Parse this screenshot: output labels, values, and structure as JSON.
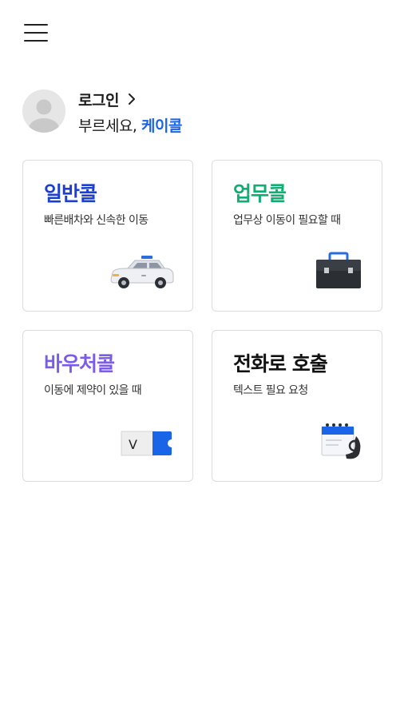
{
  "header": {
    "menu_icon": "hamburger-menu-icon"
  },
  "profile": {
    "avatar_icon": "default-user-avatar-icon",
    "login_label": "로그인",
    "chevron_icon": "chevron-right-icon",
    "greeting_prefix": "부르세요,",
    "greeting_brand": "케이콜"
  },
  "cards": [
    {
      "title": "일반콜",
      "description": "빠른배차와 신속한 이동",
      "title_color": "#1a3fd1",
      "icon": "taxi-car-icon"
    },
    {
      "title": "업무콜",
      "description": "업무상 이동이 필요할 때",
      "title_color": "#0fae72",
      "icon": "briefcase-icon"
    },
    {
      "title": "바우처콜",
      "description": "이동에 제약이 있을 때",
      "title_color": "#7b5bea",
      "icon": "voucher-ticket-icon",
      "icon_letter": "V"
    },
    {
      "title": "전화로 호출",
      "description": "텍스트 필요 요청",
      "title_color": "#111111",
      "icon": "calendar-phone-icon"
    }
  ],
  "colors": {
    "brand_blue": "#1a64e8",
    "card_border": "#dcdcdc"
  }
}
